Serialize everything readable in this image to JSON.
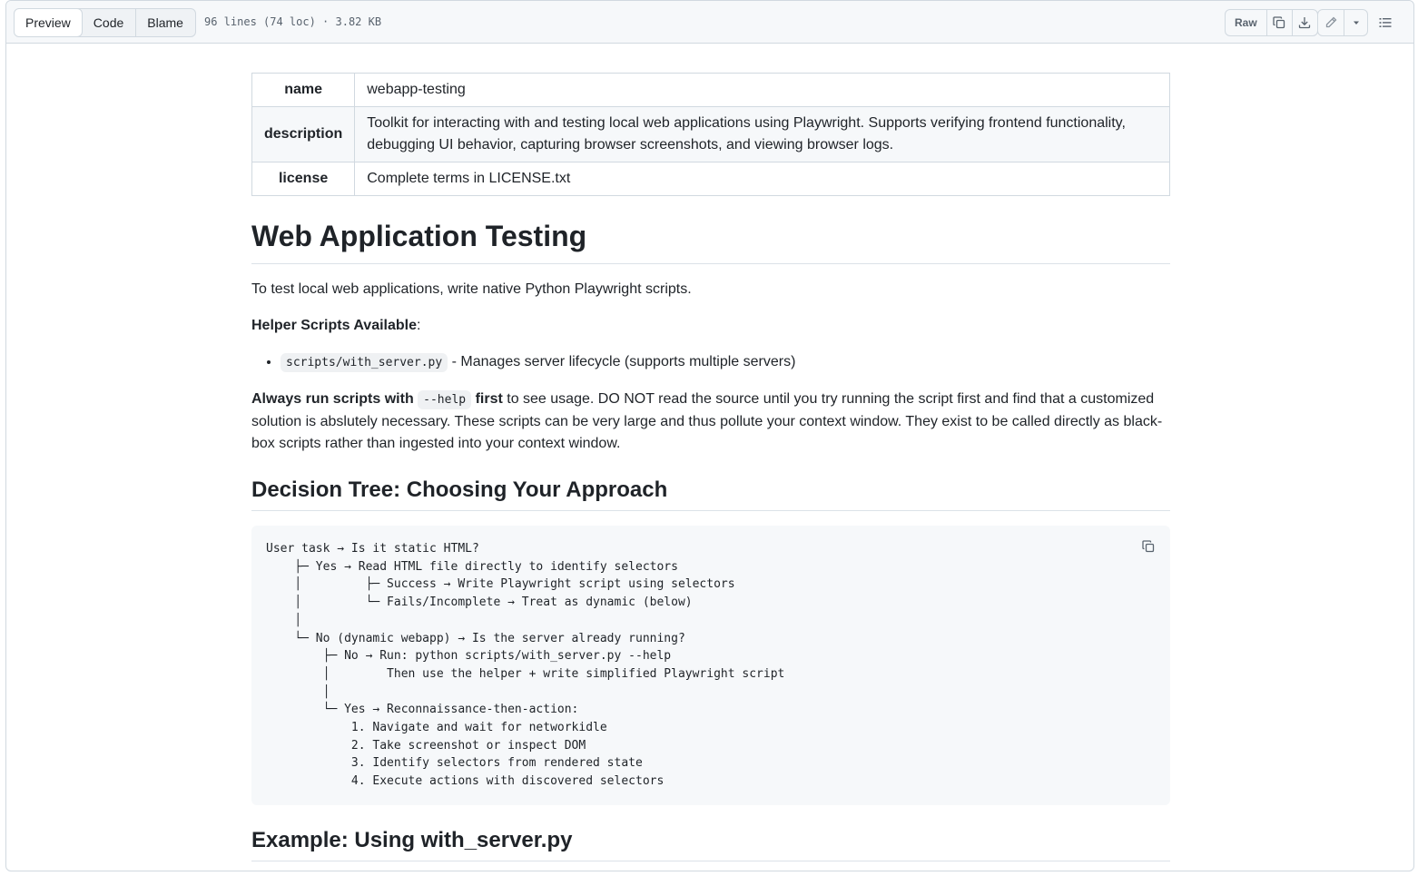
{
  "header": {
    "tabs": [
      {
        "label": "Preview",
        "active": true
      },
      {
        "label": "Code",
        "active": false
      },
      {
        "label": "Blame",
        "active": false
      }
    ],
    "file_meta": "96 lines (74 loc) · 3.82 KB",
    "raw_label": "Raw",
    "icons": [
      "copy-icon",
      "download-icon",
      "pencil-icon",
      "chevron-down-icon",
      "list-unordered-icon"
    ]
  },
  "frontmatter": {
    "rows": [
      {
        "key": "name",
        "value": "webapp-testing"
      },
      {
        "key": "description",
        "value": "Toolkit for interacting with and testing local web applications using Playwright. Supports verifying frontend functionality, debugging UI behavior, capturing browser screenshots, and viewing browser logs."
      },
      {
        "key": "license",
        "value": "Complete terms in LICENSE.txt"
      }
    ]
  },
  "doc": {
    "title": "Web Application Testing",
    "intro": "To test local web applications, write native Python Playwright scripts.",
    "helper_heading": "Helper Scripts Available",
    "helper_colon": ":",
    "helper_item_code": "scripts/with_server.py",
    "helper_item_text": " - Manages server lifecycle (supports multiple servers)",
    "always_bold_1": "Always run scripts with ",
    "always_code": "--help",
    "always_bold_2": " first",
    "always_rest": " to see usage. DO NOT read the source until you try running the script first and find that a customized solution is abslutely necessary. These scripts can be very large and thus pollute your context window. They exist to be called directly as black-box scripts rather than ingested into your context window.",
    "decision_heading": "Decision Tree: Choosing Your Approach",
    "decision_code": "User task → Is it static HTML?\n    ├─ Yes → Read HTML file directly to identify selectors\n    │         ├─ Success → Write Playwright script using selectors\n    │         └─ Fails/Incomplete → Treat as dynamic (below)\n    │\n    └─ No (dynamic webapp) → Is the server already running?\n        ├─ No → Run: python scripts/with_server.py --help\n        │        Then use the helper + write simplified Playwright script\n        │\n        └─ Yes → Reconnaissance-then-action:\n            1. Navigate and wait for networkidle\n            2. Take screenshot or inspect DOM\n            3. Identify selectors from rendered state\n            4. Execute actions with discovered selectors",
    "example_heading": "Example: Using with_server.py"
  }
}
